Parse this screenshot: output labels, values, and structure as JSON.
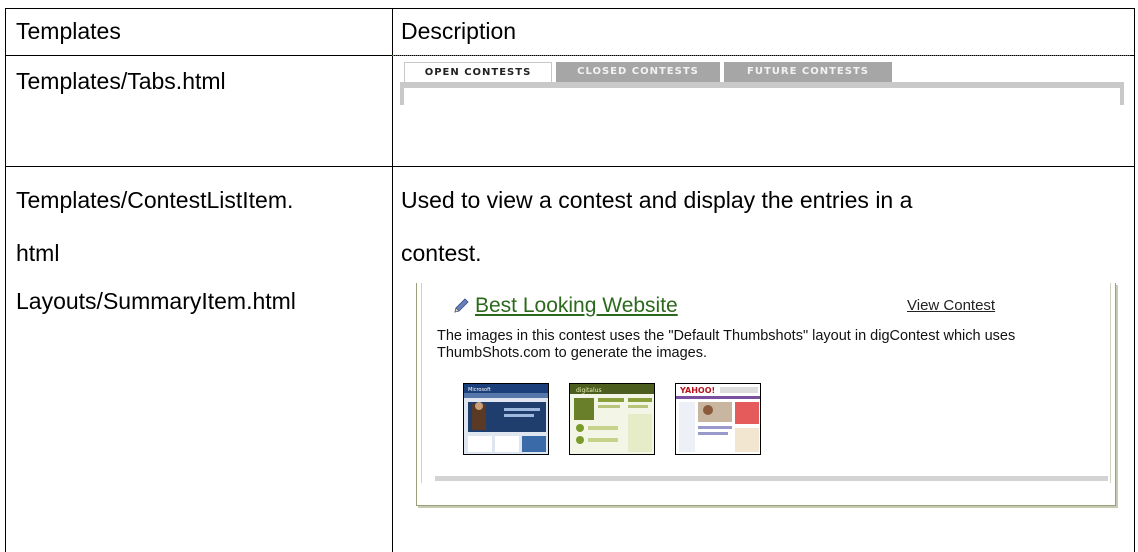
{
  "table": {
    "headers": {
      "templates": "Templates",
      "description": "Description"
    },
    "rows": [
      {
        "template": "Templates/Tabs.html"
      },
      {
        "template_lines": [
          "Templates/ContestListItem.",
          "html",
          "Layouts/SummaryItem.html"
        ],
        "description_lines": [
          "Used to view a contest and display the entries in a",
          "contest."
        ]
      }
    ]
  },
  "tabs_screenshot": {
    "tabs": [
      {
        "label": "OPEN CONTESTS",
        "active": true
      },
      {
        "label": "CLOSED CONTESTS",
        "active": false
      },
      {
        "label": "FUTURE CONTESTS",
        "active": false
      }
    ]
  },
  "contest_card": {
    "title": "Best Looking Website",
    "view_link": "View Contest",
    "description": "The images in this contest uses the \"Default Thumbshots\" layout in digContest which uses ThumbShots.com to generate the images.",
    "thumbnail_labels": [
      "Microsoft",
      "digitalus",
      "YAHOO!"
    ],
    "colors": {
      "title": "#2b6a1d",
      "tab_inactive": "#a6a6a6",
      "frame": "#9aa07a"
    }
  }
}
